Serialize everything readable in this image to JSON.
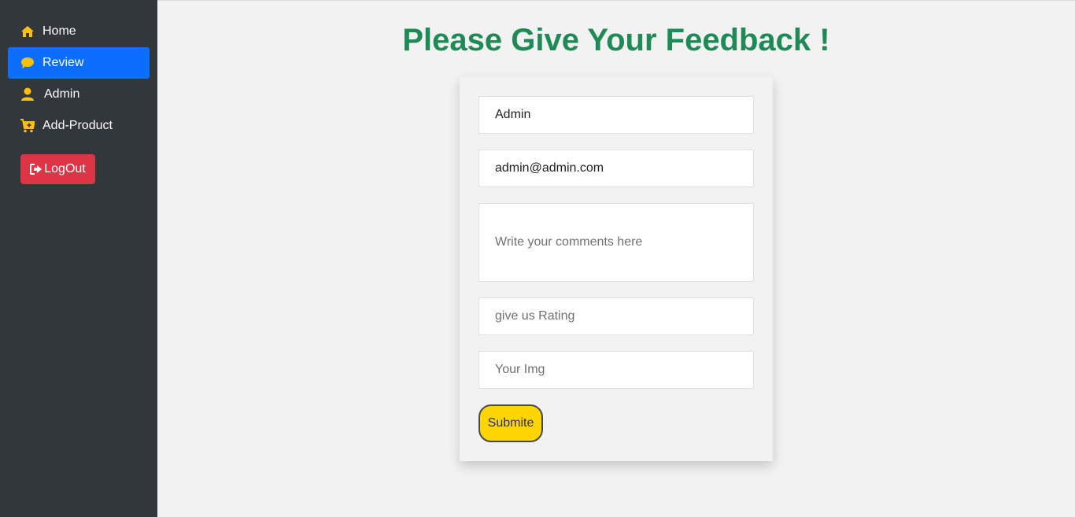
{
  "sidebar": {
    "items": [
      {
        "label": "Home",
        "icon": "home-icon",
        "active": false
      },
      {
        "label": "Review",
        "icon": "comment-icon",
        "active": true
      },
      {
        "label": "Admin",
        "icon": "user-icon",
        "active": false
      },
      {
        "label": "Add-Product",
        "icon": "cart-plus-icon",
        "active": false
      }
    ],
    "logout_label": "LogOut",
    "colors": {
      "background": "#31373b",
      "active": "#0d6efd",
      "icon": "#ffc107",
      "logout": "#dc3545"
    }
  },
  "main": {
    "title": "Please Give Your Feedback !",
    "title_color": "#1e8a55",
    "form": {
      "name_value": "Admin",
      "email_value": "admin@admin.com",
      "comments_placeholder": "Write your comments here",
      "rating_placeholder": "give us Rating",
      "img_placeholder": "Your Img",
      "submit_label": "Submite",
      "submit_color": "#ffd500"
    }
  }
}
